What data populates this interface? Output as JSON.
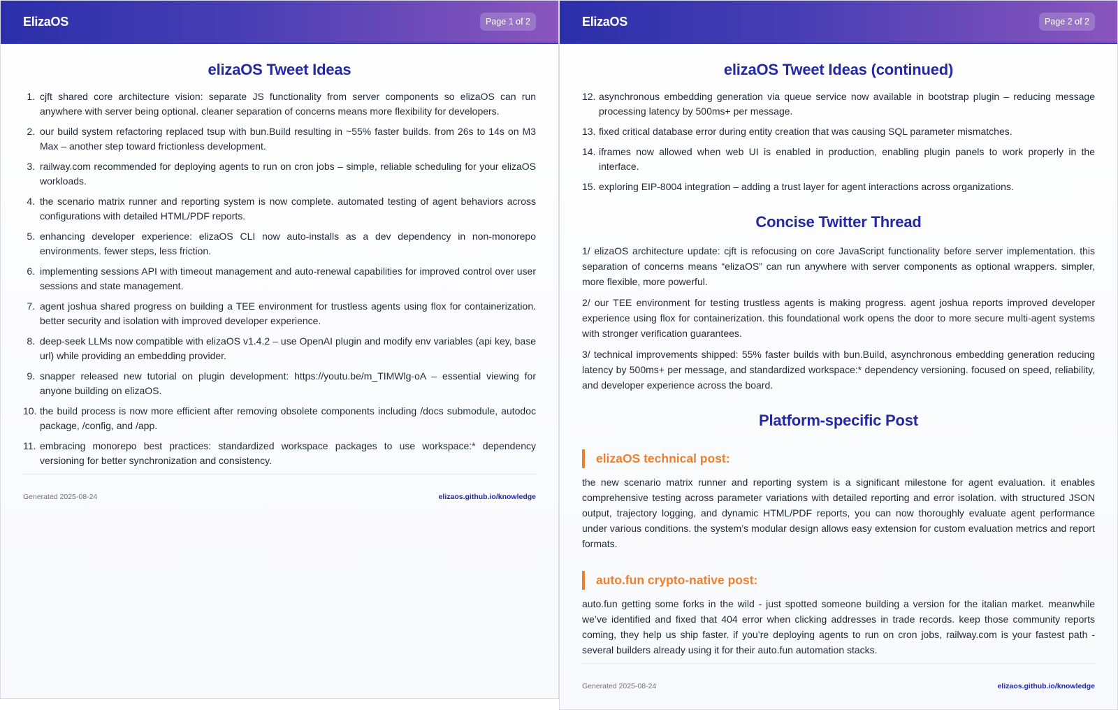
{
  "brand": "ElizaOS",
  "page1": {
    "badge": "Page 1 of 2",
    "title": "elizaOS Tweet Ideas",
    "items": [
      {
        "num": "1.",
        "text": "cjft shared core architecture vision: separate JS functionality from server components so elizaOS can run anywhere with server being optional. cleaner separation of concerns means more flexibility for developers."
      },
      {
        "num": "2.",
        "text": "our build system refactoring replaced tsup with bun.Build resulting in ~55% faster builds. from 26s to 14s on M3 Max – another step toward frictionless development."
      },
      {
        "num": "3.",
        "text": "railway.com recommended for deploying agents to run on cron jobs – simple, reliable scheduling for your elizaOS workloads."
      },
      {
        "num": "4.",
        "text": "the scenario matrix runner and reporting system is now complete. automated testing of agent behaviors across configurations with detailed HTML/PDF reports."
      },
      {
        "num": "5.",
        "text": "enhancing developer experience: elizaOS CLI now auto-installs as a dev dependency in non-monorepo environments. fewer steps, less friction."
      },
      {
        "num": "6.",
        "text": "implementing sessions API with timeout management and auto-renewal capabilities for improved control over user sessions and state management."
      },
      {
        "num": "7.",
        "text": "agent joshua shared progress on building a TEE environment for trustless agents using flox for containerization. better security and isolation with improved developer experience."
      },
      {
        "num": "8.",
        "text": "deep-seek LLMs now compatible with elizaOS v1.4.2 – use OpenAI plugin and modify env variables (api key, base url) while providing an embedding provider."
      },
      {
        "num": "9.",
        "text": "snapper released new tutorial on plugin development: https://youtu.be/m_TIMWlg-oA – essential viewing for anyone building on elizaOS."
      },
      {
        "num": "10.",
        "text": "the build process is now more efficient after removing obsolete components including /docs submodule, autodoc package, /config, and /app."
      },
      {
        "num": "11.",
        "text": "embracing monorepo best practices: standardized workspace packages to use workspace:* dependency versioning for better synchronization and consistency."
      }
    ],
    "footer_generated": "Generated 2025-08-24",
    "footer_link": "elizaos.github.io/knowledge"
  },
  "page2": {
    "badge": "Page 2 of 2",
    "title": "elizaOS Tweet Ideas (continued)",
    "items": [
      {
        "num": "12.",
        "text": "asynchronous embedding generation via queue service now available in bootstrap plugin – reducing message processing latency by 500ms+ per message."
      },
      {
        "num": "13.",
        "text": "fixed critical database error during entity creation that was causing SQL parameter mismatches."
      },
      {
        "num": "14.",
        "text": "iframes now allowed when web UI is enabled in production, enabling plugin panels to work properly in the interface."
      },
      {
        "num": "15.",
        "text": "exploring EIP-8004 integration – adding a trust layer for agent interactions across organizations."
      }
    ],
    "thread_title": "Concise Twitter Thread",
    "thread": [
      "1/ elizaOS architecture update: cjft is refocusing on core JavaScript functionality before server implementation. this separation of concerns means “elizaOS” can run anywhere with server components as optional wrappers. simpler, more flexible, more powerful.",
      "2/ our TEE environment for testing trustless agents is making progress. agent joshua reports improved developer experience using flox for containerization. this foundational work opens the door to more secure multi-agent systems with stronger verification guarantees.",
      "3/ technical improvements shipped: 55% faster builds with bun.Build, asynchronous embedding generation reducing latency by 500ms+ per message, and standardized workspace:* dependency versioning. focused on speed, reliability, and developer experience across the board."
    ],
    "platform_title": "Platform-specific Post",
    "technical_heading": "elizaOS technical post:",
    "technical_body": "the new scenario matrix runner and reporting system is a significant milestone for agent evaluation. it enables comprehensive testing across parameter variations with detailed reporting and error isolation. with structured JSON output, trajectory logging, and dynamic HTML/PDF reports, you can now thoroughly evaluate agent performance under various conditions. the system’s modular design allows easy extension for custom evaluation metrics and report formats.",
    "crypto_heading": "auto.fun crypto-native post:",
    "crypto_body": "auto.fun getting some forks in the wild - just spotted someone building a version for the italian market. meanwhile we’ve identified and fixed that 404 error when clicking addresses in trade records. keep those community reports coming, they help us ship faster. if you’re deploying agents to run on cron jobs, railway.com is your fastest path - several builders already using it for their auto.fun automation stacks.",
    "footer_generated": "Generated 2025-08-24",
    "footer_link": "elizaos.github.io/knowledge"
  },
  "colors": {
    "header_start": "#2b2fab",
    "header_end": "#8a55bd",
    "heading_blue": "#2328a3",
    "accent_orange": "#ee7f2d"
  }
}
